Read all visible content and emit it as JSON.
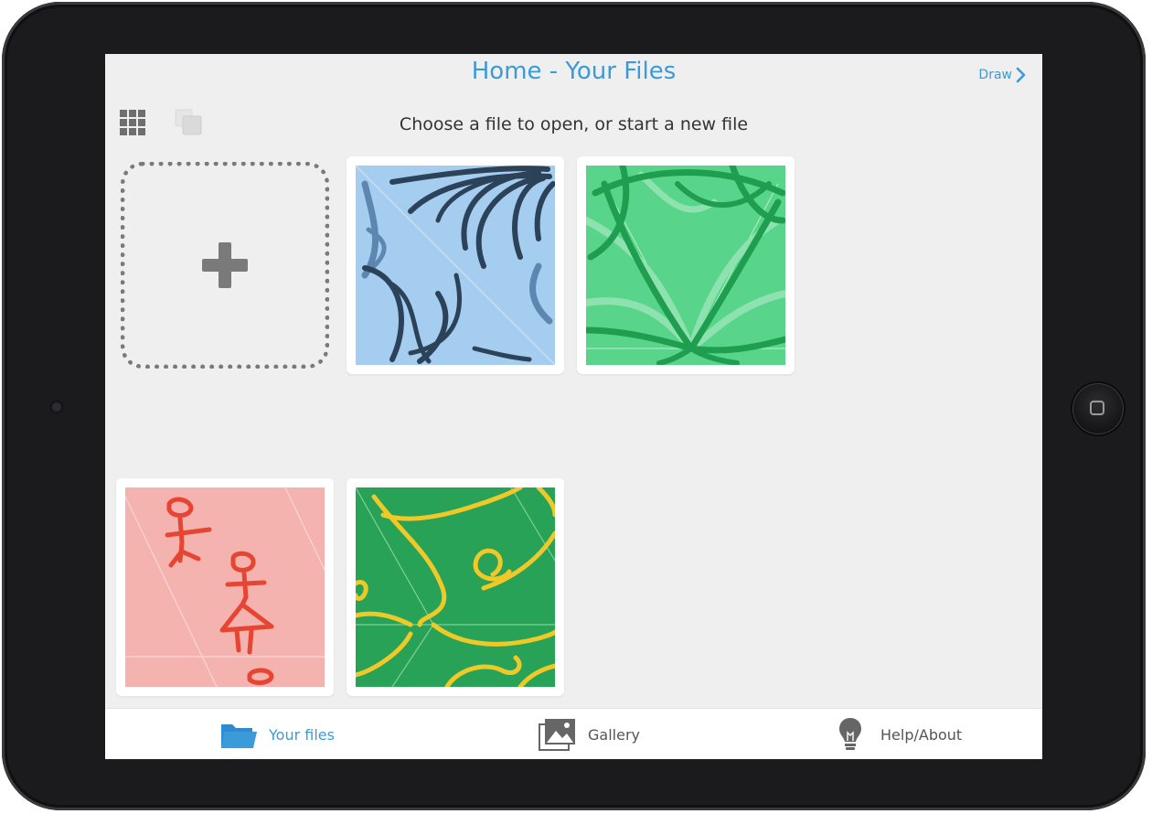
{
  "header": {
    "title": "Home - Your Files",
    "draw_label": "Draw",
    "subtitle": "Choose a file to open, or start a new file"
  },
  "files": [
    {
      "name": "blue-waves",
      "background": "#a4cdef",
      "stroke": "#2c4258"
    },
    {
      "name": "green-lines",
      "background": "#58d58a",
      "stroke": "#1f9e50"
    },
    {
      "name": "pink-stick-figures",
      "background": "#f4b3ae",
      "stroke": "#e64533"
    },
    {
      "name": "yellow-swirls",
      "background": "#27a257",
      "stroke": "#f0c929"
    }
  ],
  "tabs": [
    {
      "label": "Your files",
      "icon": "folder-icon",
      "active": true
    },
    {
      "label": "Gallery",
      "icon": "gallery-icon",
      "active": false
    },
    {
      "label": "Help/About",
      "icon": "lightbulb-icon",
      "active": false
    }
  ],
  "colors": {
    "accent": "#3a9bd8",
    "inactive": "#555555"
  }
}
